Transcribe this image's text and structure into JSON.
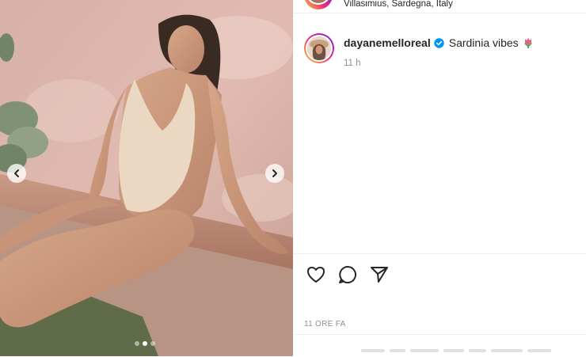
{
  "post": {
    "location": "Villasimius, Sardegna, Italy",
    "username": "dayanemelloreal",
    "caption": "Sardinia vibes",
    "caption_emoji": "tulip-icon",
    "time_ago": "11 h",
    "date_label": "11 ORE FA",
    "carousel": {
      "total": 3,
      "active_index": 1
    }
  },
  "icons": {
    "like": "heart-icon",
    "comment": "comment-bubble-icon",
    "share": "paper-plane-icon",
    "prev": "chevron-left-icon",
    "next": "chevron-right-icon",
    "verified": "verified-badge-icon"
  },
  "colors": {
    "verified_blue": "#0095f6",
    "muted_text": "#8e8e8e",
    "primary_text": "#262626",
    "wall_pink": "#d9b2a8"
  }
}
